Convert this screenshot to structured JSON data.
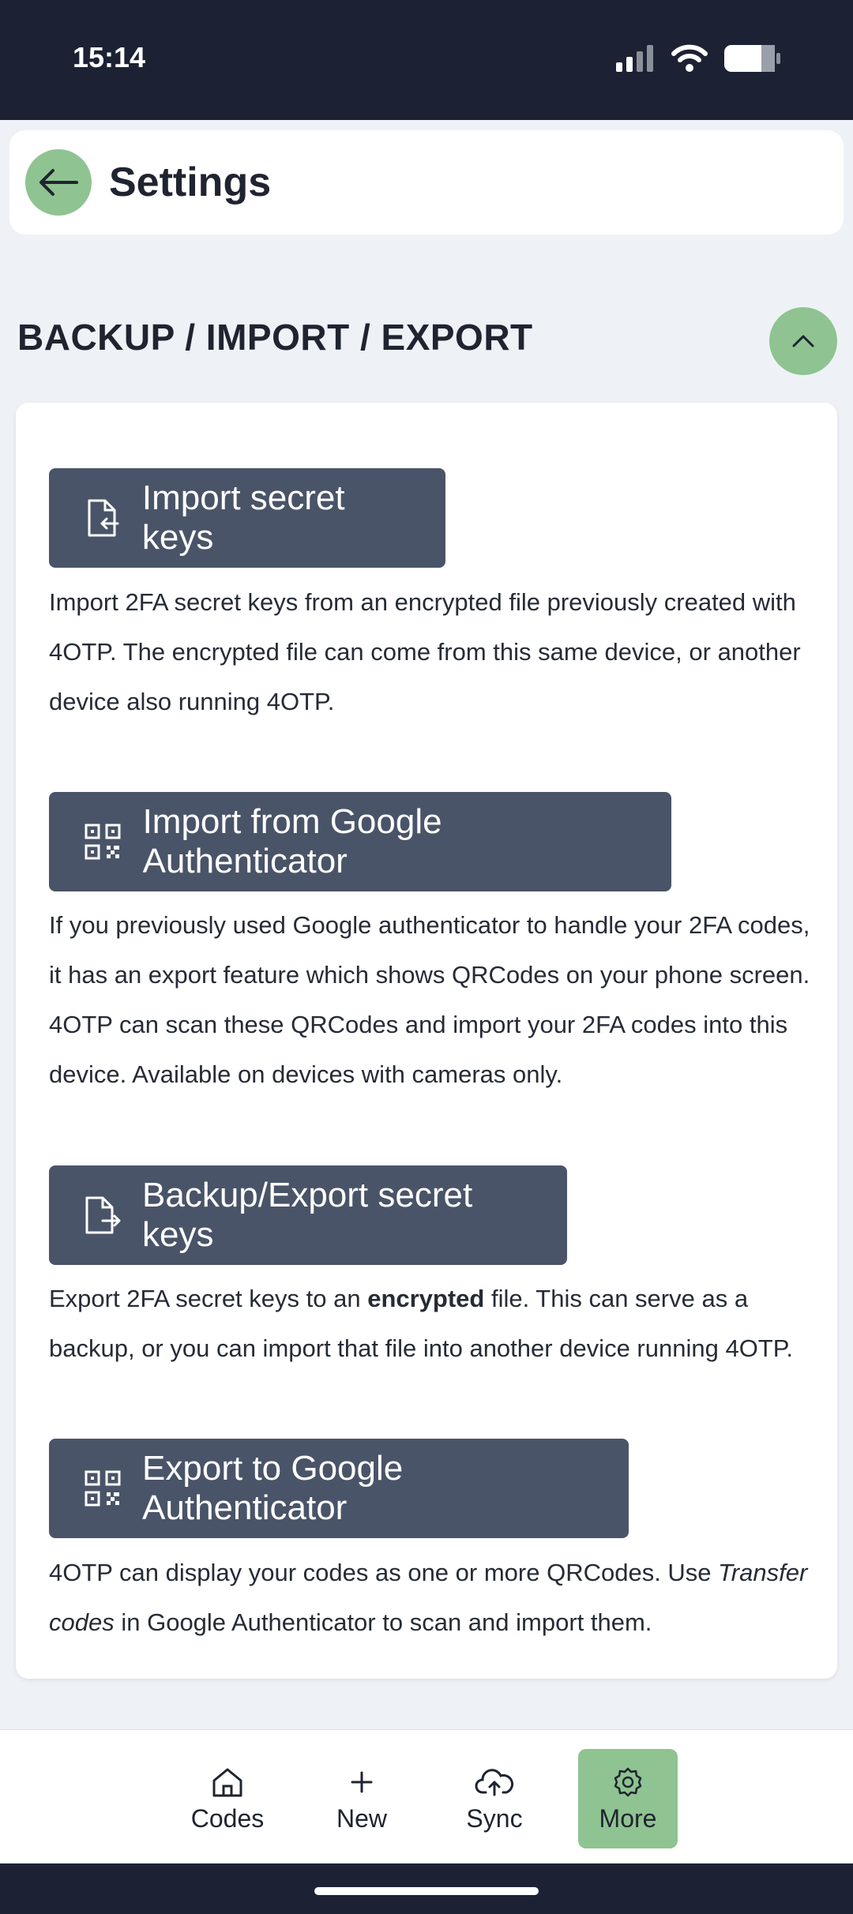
{
  "status_bar": {
    "time": "15:14"
  },
  "header": {
    "title": "Settings"
  },
  "section": {
    "title": "BACKUP / IMPORT / EXPORT"
  },
  "actions": [
    {
      "label": "Import secret keys",
      "icon": "file-import-icon",
      "description": "Import 2FA secret keys from an encrypted file previously created with 4OTP. The encrypted file can come from this same device, or another device also running 4OTP."
    },
    {
      "label": "Import from Google Authenticator",
      "icon": "qrcode-icon",
      "description": "If you previously used Google authenticator to handle your 2FA codes, it has an export feature which shows QRCodes on your phone screen. 4OTP can scan these QRCodes and import your 2FA codes into this device. Available on devices with cameras only."
    },
    {
      "label": "Backup/Export secret keys",
      "icon": "file-export-icon",
      "description_pre": "Export 2FA secret keys to an ",
      "description_bold": "encrypted",
      "description_post": " file. This can serve as a backup, or you can import that file into another device running 4OTP."
    },
    {
      "label": "Export to Google Authenticator",
      "icon": "qrcode-icon",
      "description_pre": "4OTP can display your codes as one or more QRCodes. Use ",
      "description_italic": "Transfer codes",
      "description_post": " in Google Authenticator to scan and import them."
    }
  ],
  "bottom_nav": [
    {
      "label": "Codes",
      "icon": "home-icon",
      "active": false
    },
    {
      "label": "New",
      "icon": "plus-icon",
      "active": false
    },
    {
      "label": "Sync",
      "icon": "cloud-sync-icon",
      "active": false
    },
    {
      "label": "More",
      "icon": "gear-icon",
      "active": true
    }
  ],
  "colors": {
    "accent": "#8fc391",
    "button": "#4a5468",
    "background": "#eef2f7",
    "status_bar": "#1c2233"
  }
}
